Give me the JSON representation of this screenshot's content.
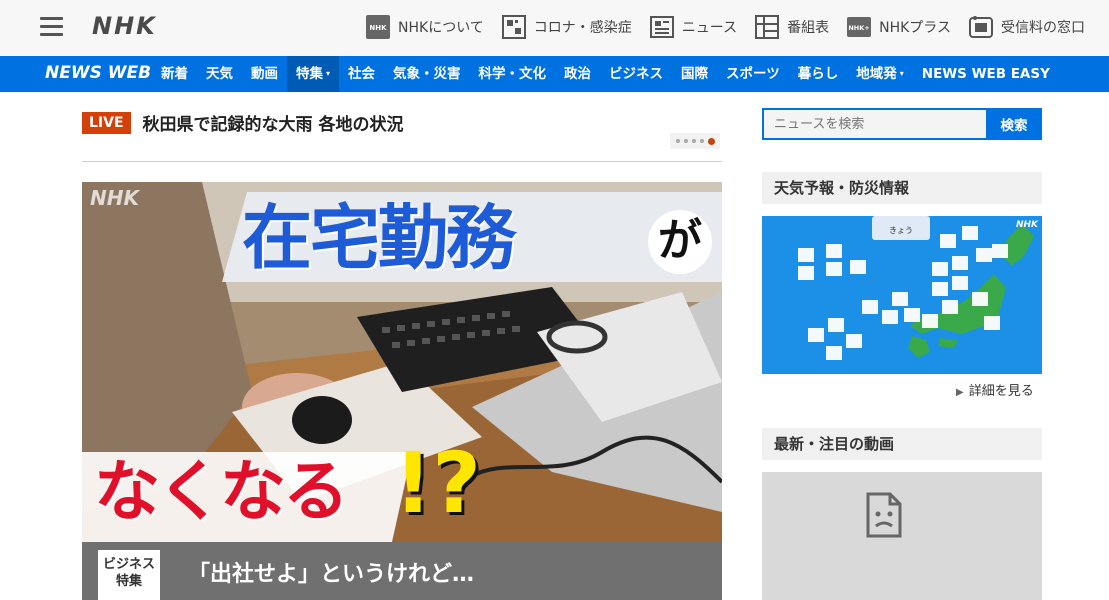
{
  "header": {
    "logo": "NHK",
    "links": [
      {
        "label": "NHKについて",
        "icon": "nhk-logo-icon"
      },
      {
        "label": "コロナ・感染症",
        "icon": "virus-icon"
      },
      {
        "label": "ニュース",
        "icon": "news-icon"
      },
      {
        "label": "番組表",
        "icon": "grid-icon"
      },
      {
        "label": "NHKプラス",
        "icon": "nhkplus-icon"
      },
      {
        "label": "受信料の窓口",
        "icon": "reception-icon"
      }
    ]
  },
  "nav": {
    "brand": "NEWS WEB",
    "items": [
      {
        "label": "新着"
      },
      {
        "label": "天気"
      },
      {
        "label": "動画"
      },
      {
        "label": "特集",
        "dropdown": true,
        "active": true
      },
      {
        "label": "社会"
      },
      {
        "label": "気象・災害"
      },
      {
        "label": "科学・文化"
      },
      {
        "label": "政治"
      },
      {
        "label": "ビジネス"
      },
      {
        "label": "国際"
      },
      {
        "label": "スポーツ"
      },
      {
        "label": "暮らし"
      },
      {
        "label": "地域発",
        "dropdown": true
      },
      {
        "label": "NEWS WEB EASY"
      }
    ],
    "caret": "▾"
  },
  "live": {
    "badge": "LIVE",
    "headline": "秋田県で記録的な大雨 各地の状況"
  },
  "feature": {
    "watermark": "NHK",
    "title_top": "在宅勤務",
    "title_top_suffix": "が",
    "title_bottom": "なくなる",
    "title_bottom_suffix": "!?",
    "caption_badge_line1": "ビジネス",
    "caption_badge_line2": "特集",
    "caption": "「出社せよ」というけれど…"
  },
  "search": {
    "placeholder": "ニュースを検索",
    "button": "検索"
  },
  "weather": {
    "heading": "天気予報・防災情報",
    "map_label": "きょう",
    "map_logo": "NHK",
    "more": "詳細を見る"
  },
  "videos": {
    "heading": "最新・注目の動画"
  },
  "colors": {
    "nav_blue": "#0071e0",
    "live_red": "#d4400a"
  }
}
